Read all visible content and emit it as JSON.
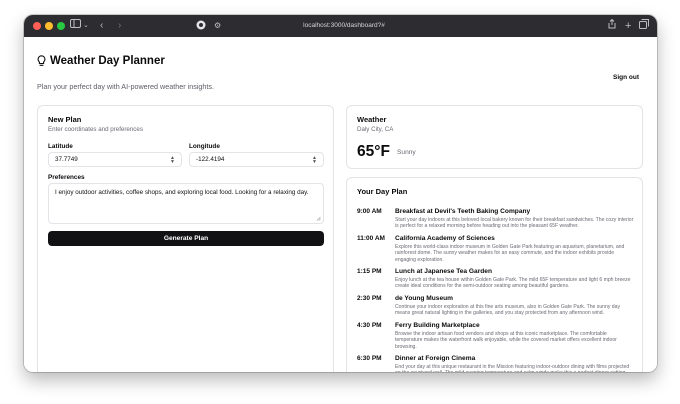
{
  "browser": {
    "url": "localhost:3000/dashboard?#",
    "lights": {
      "close": "#ff5f57",
      "minimize": "#febc2e",
      "maximize": "#28c840"
    }
  },
  "header": {
    "title": "Weather Day Planner",
    "subtitle": "Plan your perfect day with AI-powered weather insights.",
    "sign_out": "Sign out"
  },
  "new_plan": {
    "title": "New Plan",
    "description": "Enter coordinates and preferences",
    "latitude_label": "Latitude",
    "latitude_value": "37.7749",
    "longitude_label": "Longitude",
    "longitude_value": "-122.4194",
    "preferences_label": "Preferences",
    "preferences_value": "I enjoy outdoor activities, coffee shops, and exploring local food. Looking for a relaxing day.",
    "generate_button": "Generate Plan"
  },
  "weather": {
    "title": "Weather",
    "location": "Daly City, CA",
    "temperature": "65°F",
    "condition": "Sunny"
  },
  "day_plan": {
    "title": "Your Day Plan",
    "items": [
      {
        "time": "9:00 AM",
        "title": "Breakfast at Devil's Teeth Baking Company",
        "description": "Start your day indoors at this beloved local bakery known for their breakfast sandwiches. The cozy interior is perfect for a relaxed morning before heading out into the pleasant 65F weather."
      },
      {
        "time": "11:00 AM",
        "title": "California Academy of Sciences",
        "description": "Explore this world-class indoor museum in Golden Gate Park featuring an aquarium, planetarium, and rainforest dome. The sunny weather makes for an easy commute, and the indoor exhibits provide engaging exploration."
      },
      {
        "time": "1:15 PM",
        "title": "Lunch at Japanese Tea Garden",
        "description": "Enjoy lunch at the tea house within Golden Gate Park. The mild 65F temperature and light 6 mph breeze create ideal conditions for the semi-outdoor seating among beautiful gardens."
      },
      {
        "time": "2:30 PM",
        "title": "de Young Museum",
        "description": "Continue your indoor exploration at this fine arts museum, also in Golden Gate Park. The sunny day means great natural lighting in the galleries, and you stay protected from any afternoon wind."
      },
      {
        "time": "4:30 PM",
        "title": "Ferry Building Marketplace",
        "description": "Browse the indoor artisan food vendors and shops at this iconic marketplace. The comfortable temperature makes the waterfront walk enjoyable, while the covered market offers excellent indoor browsing."
      },
      {
        "time": "6:30 PM",
        "title": "Dinner at Foreign Cinema",
        "description": "End your day at this unique restaurant in the Mission featuring indoor-outdoor dining with films projected on the courtyard wall. The mild evening temperature and calm winds make this a perfect dinner setting."
      }
    ]
  }
}
